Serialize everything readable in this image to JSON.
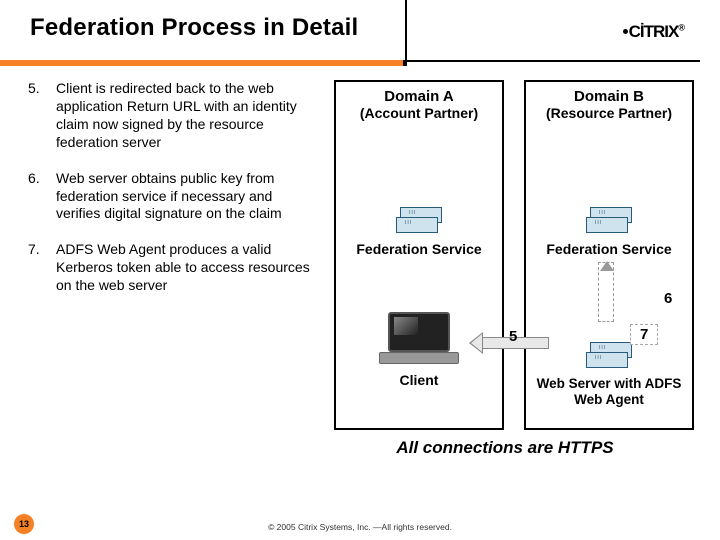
{
  "header": {
    "title": "Federation Process in Detail",
    "logo_text": "CİTRIX",
    "logo_reg": "®"
  },
  "steps": [
    {
      "num": "5.",
      "text": "Client is redirected back to the web application Return URL with an identity claim now signed by the resource federation server"
    },
    {
      "num": "6.",
      "text": "Web server obtains public key from federation service if necessary and verifies digital signature on the claim"
    },
    {
      "num": "7.",
      "text": "ADFS Web Agent produces a valid Kerberos token able to access resources on the web server"
    }
  ],
  "diagram": {
    "domainA": {
      "title": "Domain A",
      "subtitle": "(Account Partner)",
      "fed_label": "Federation Service",
      "client_label": "Client"
    },
    "domainB": {
      "title": "Domain B",
      "subtitle": "(Resource Partner)",
      "fed_label": "Federation Service",
      "ws_label": "Web Server with ADFS Web Agent"
    },
    "arrow_labels": {
      "a5": "5",
      "a6": "6",
      "a7": "7"
    },
    "footnote": "All connections are HTTPS"
  },
  "footer": {
    "copyright": "© 2005 Citrix Systems, Inc. —All rights reserved.",
    "page": "13"
  }
}
